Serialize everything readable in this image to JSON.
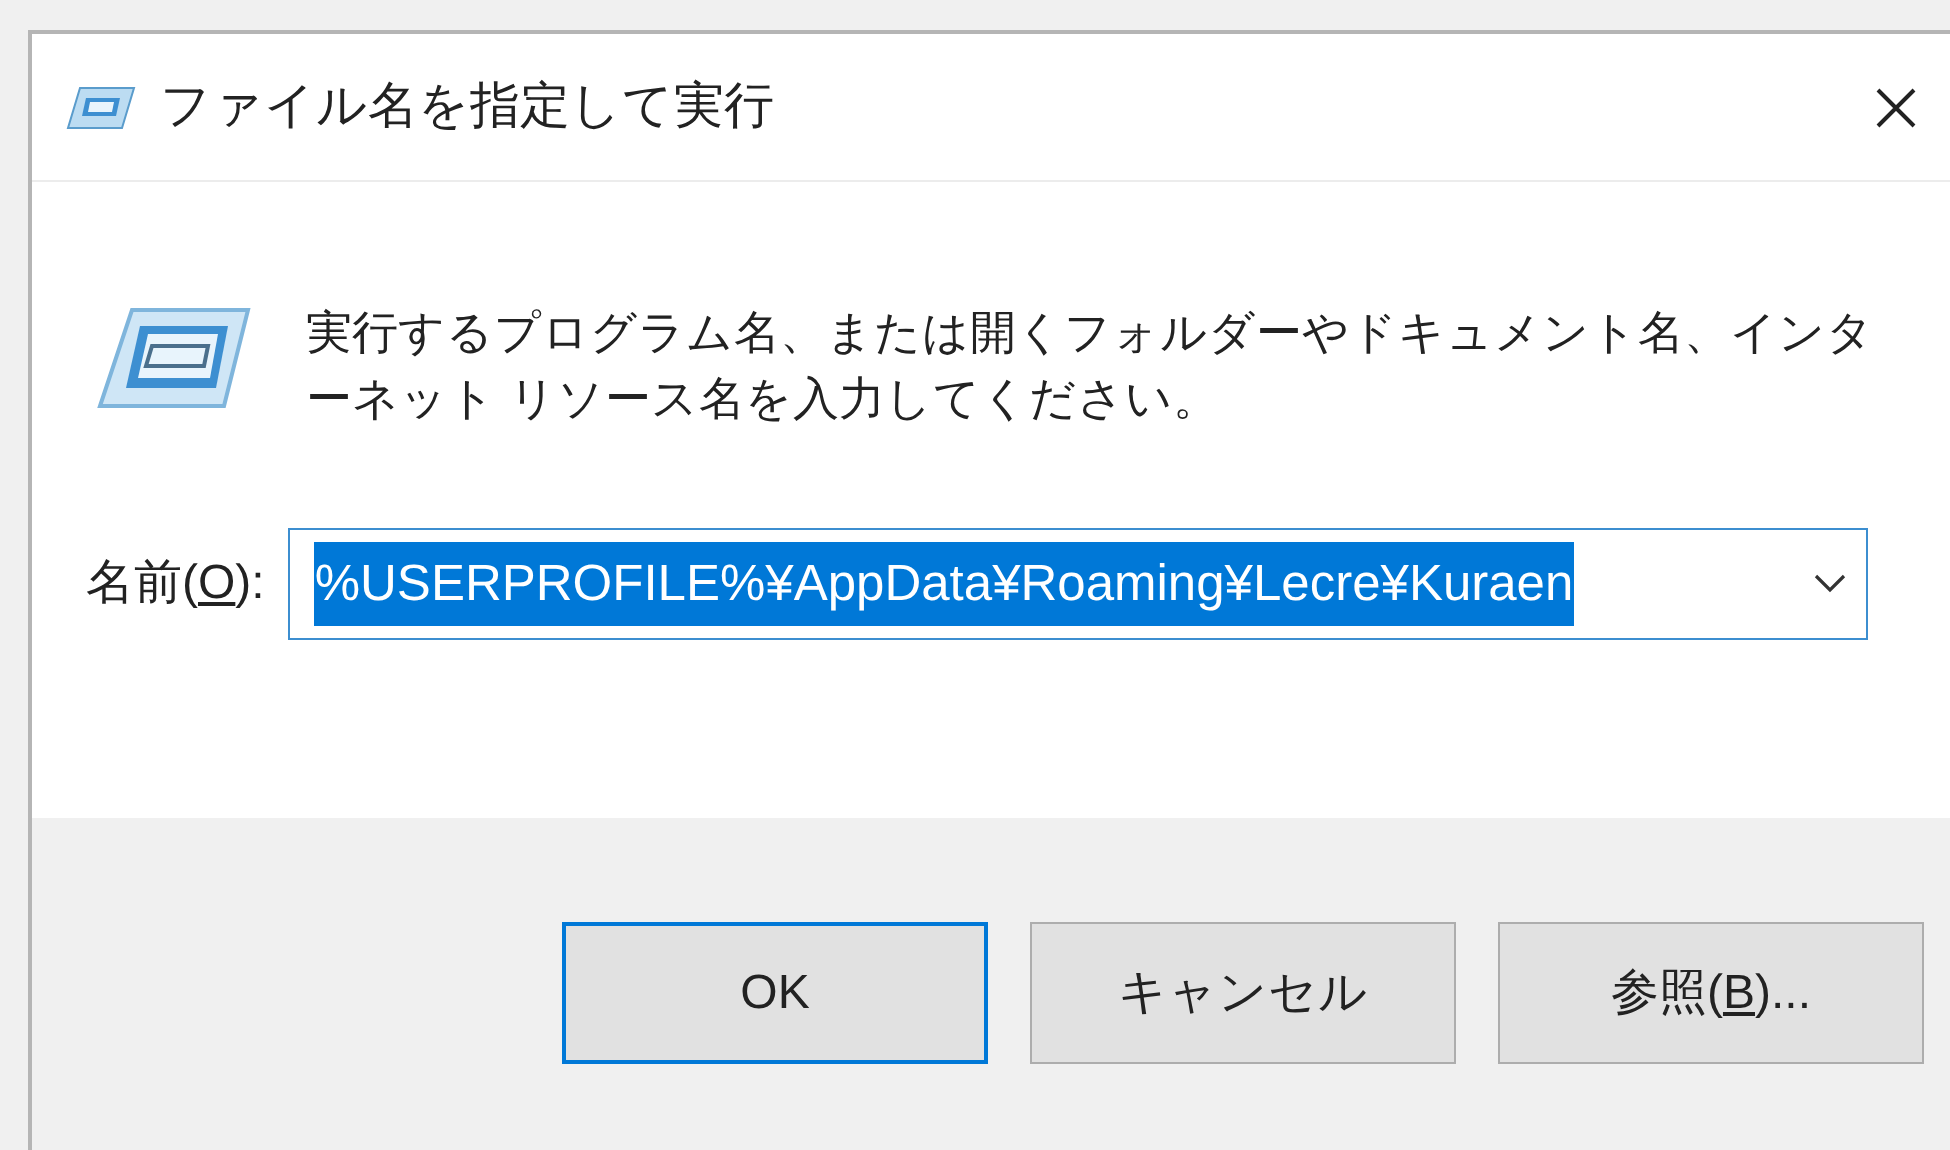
{
  "window": {
    "title": "ファイル名を指定して実行"
  },
  "message": "実行するプログラム名、または開くフォルダーやドキュメント名、インターネット リソース名を入力してください。",
  "name_field": {
    "label": {
      "before": "名前(",
      "key": "O",
      "after": "):"
    },
    "value": "%USERPROFILE%¥AppData¥Roaming¥Lecre¥Kuraen",
    "selected": true
  },
  "buttons": [
    {
      "label": {
        "before": "OK"
      },
      "default": true
    },
    {
      "label": {
        "before": "キャンセル"
      },
      "default": false
    },
    {
      "label": {
        "before": "参照(",
        "key": "B",
        "after": ")..."
      },
      "default": false
    }
  ]
}
